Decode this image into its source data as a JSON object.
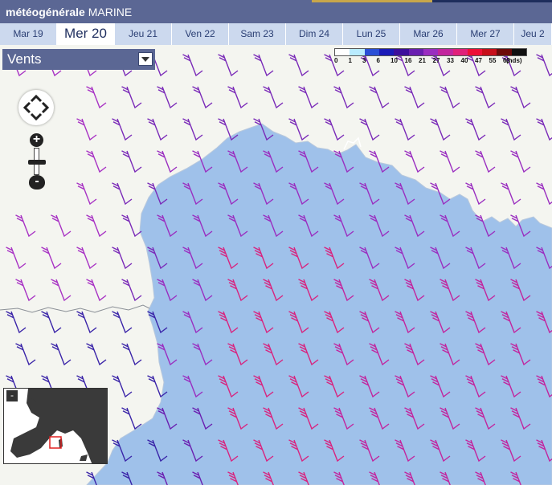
{
  "header": {
    "brand_bold": "météogénérale",
    "brand_rest": "MARINE"
  },
  "days": [
    {
      "label": "Mar 19",
      "active": false
    },
    {
      "label": "Mer 20",
      "active": true
    },
    {
      "label": "Jeu 21",
      "active": false
    },
    {
      "label": "Ven 22",
      "active": false
    },
    {
      "label": "Sam 23",
      "active": false
    },
    {
      "label": "Dim 24",
      "active": false
    },
    {
      "label": "Lun 25",
      "active": false
    },
    {
      "label": "Mar 26",
      "active": false
    },
    {
      "label": "Mer 27",
      "active": false
    },
    {
      "label": "Jeu 2",
      "active": false
    }
  ],
  "layer_select": {
    "label": "Vents",
    "icon": "dropdown-arrow-icon"
  },
  "legend": {
    "ticks": [
      "0",
      "1",
      "3",
      "6",
      "10",
      "16",
      "21",
      "27",
      "33",
      "40",
      "47",
      "55",
      "63"
    ],
    "unit": "(nds)",
    "colors": [
      "#ffffff",
      "#b9ecff",
      "#2a4fd6",
      "#1b1bb8",
      "#3d0f9c",
      "#6a1fb0",
      "#9a2ec0",
      "#c2259e",
      "#e0207a",
      "#ee1037",
      "#c70f1a",
      "#6d0a0a",
      "#111111"
    ]
  },
  "zoom": {
    "in_label": "+",
    "out_label": "-",
    "level": 0.5,
    "pan_icon": "pan-arrows-icon"
  },
  "overview": {
    "close_label": "-"
  },
  "colors": {
    "header": "#5b6794",
    "sea": "#9fc1ea",
    "land": "#f4f5f0",
    "tab": "#ccd9ee"
  }
}
